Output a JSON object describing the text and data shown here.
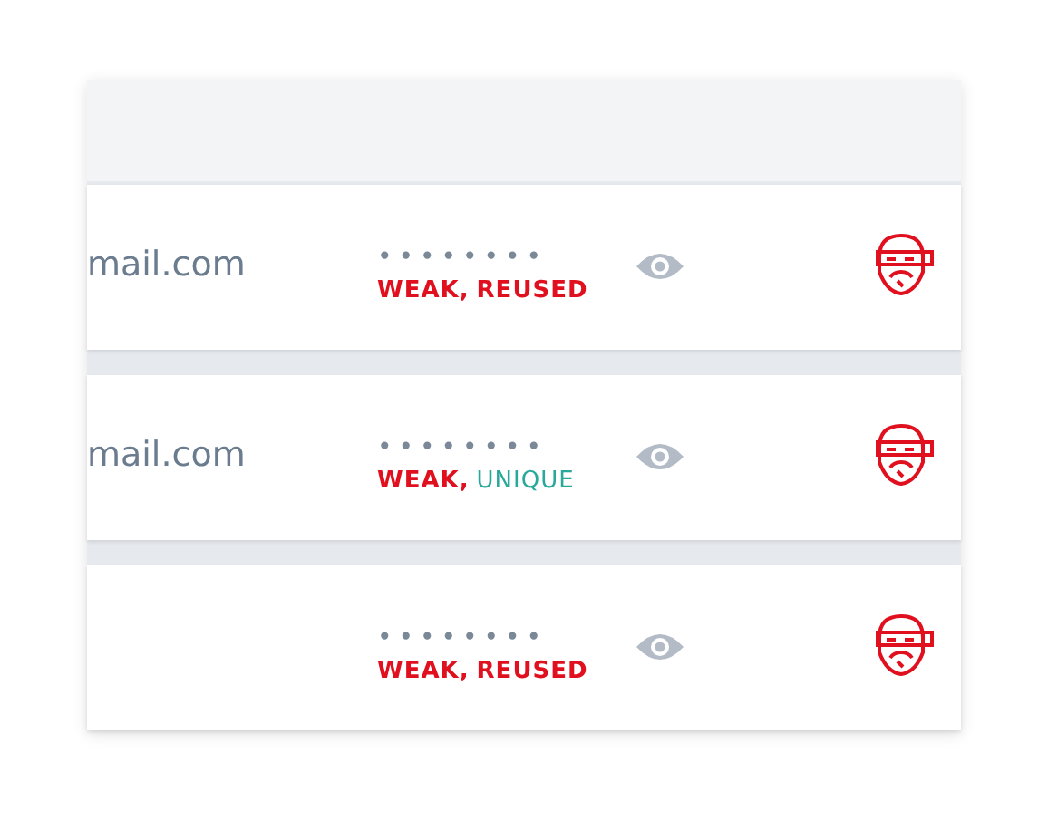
{
  "rows": [
    {
      "username": "mail.com",
      "password": "••••••••",
      "tags": [
        {
          "text": "WEAK,",
          "kind": "weak"
        },
        {
          "text": "REUSED",
          "kind": "reused"
        }
      ]
    },
    {
      "username": "mail.com",
      "password": "••••••••",
      "tags": [
        {
          "text": "WEAK,",
          "kind": "weak"
        },
        {
          "text": "UNIQUE",
          "kind": "unique"
        }
      ]
    },
    {
      "password": "••••••••",
      "tags": [
        {
          "text": "WEAK,",
          "kind": "weak"
        },
        {
          "text": "REUSED",
          "kind": "reused"
        }
      ]
    }
  ]
}
